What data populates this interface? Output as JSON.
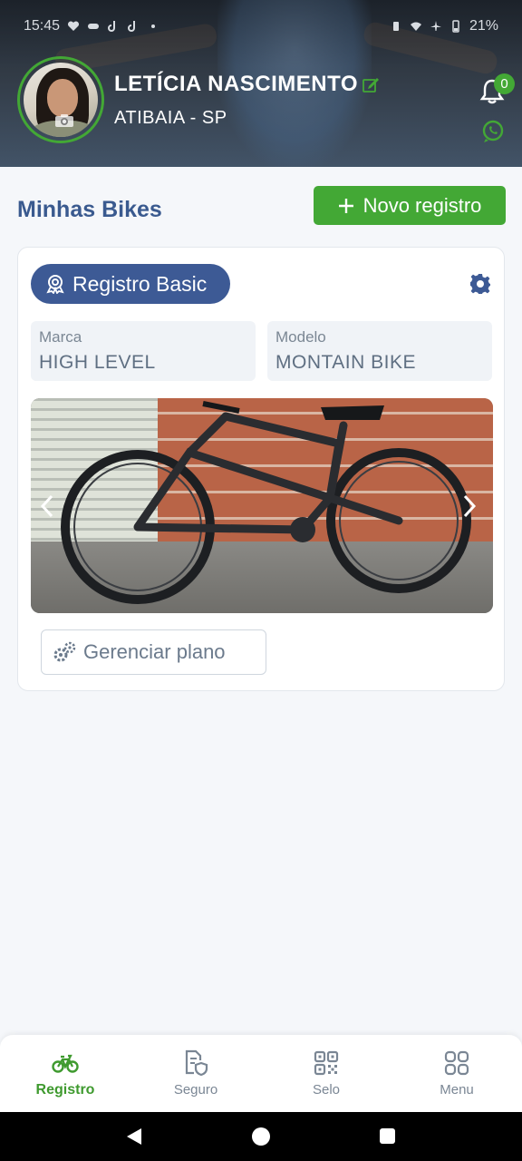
{
  "status_bar": {
    "time": "15:45",
    "battery": "21%"
  },
  "profile": {
    "name": "LETÍCIA NASCIMENTO",
    "location": "ATIBAIA - SP",
    "notifications_count": "0"
  },
  "section": {
    "title": "Minhas Bikes",
    "new_button": "Novo registro"
  },
  "bike_card": {
    "plan_badge": "Registro Basic",
    "brand_label": "Marca",
    "brand_value": "HIGH LEVEL",
    "model_label": "Modelo",
    "model_value": "MONTAIN BIKE",
    "manage_button": "Gerenciar plano"
  },
  "bottom_nav": [
    {
      "label": "Registro",
      "icon": "bike-icon",
      "active": true
    },
    {
      "label": "Seguro",
      "icon": "insurance-doc-icon",
      "active": false
    },
    {
      "label": "Selo",
      "icon": "qr-code-icon",
      "active": false
    },
    {
      "label": "Menu",
      "icon": "grid-icon",
      "active": false
    }
  ],
  "colors": {
    "accent_green": "#43a835",
    "primary_blue": "#3d5a95"
  }
}
